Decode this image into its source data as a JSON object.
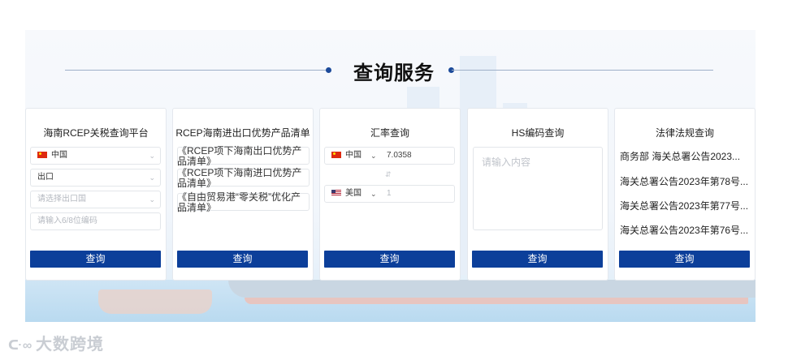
{
  "section": {
    "title": "查询服务"
  },
  "cards": {
    "tariff": {
      "title": "海南RCEP关税查询平台",
      "country": "中国",
      "direction": "出口",
      "export_country_placeholder": "请选择出口国",
      "code_placeholder": "请输入6/8位编码",
      "button": "查询"
    },
    "products": {
      "title": "RCEP海南进出口优势产品清单",
      "links": [
        "《RCEP项下海南出口优势产品清单》",
        "《RCEP项下海南进口优势产品清单》",
        "《自由贸易港“零关税”优化产品清单》"
      ],
      "button": "查询"
    },
    "exchange": {
      "title": "汇率查询",
      "from_currency": "中国",
      "from_value": "7.0358",
      "to_currency": "美国",
      "to_value": "1",
      "swap_icon": "swap-icon",
      "button": "查询"
    },
    "hs": {
      "title": "HS编码查询",
      "placeholder": "请输入内容",
      "button": "查询"
    },
    "law": {
      "title": "法律法规查询",
      "items": [
        "商务部 海关总署公告2023...",
        "海关总署公告2023年第78号...",
        "海关总署公告2023年第77号...",
        "海关总署公告2023年第76号..."
      ],
      "button": "查询"
    }
  },
  "watermark": {
    "text": "大数跨境",
    "icon": "logo-icon"
  },
  "colors": {
    "primary": "#0c3f9a",
    "title": "#111111",
    "dot": "#1c4a9a"
  }
}
